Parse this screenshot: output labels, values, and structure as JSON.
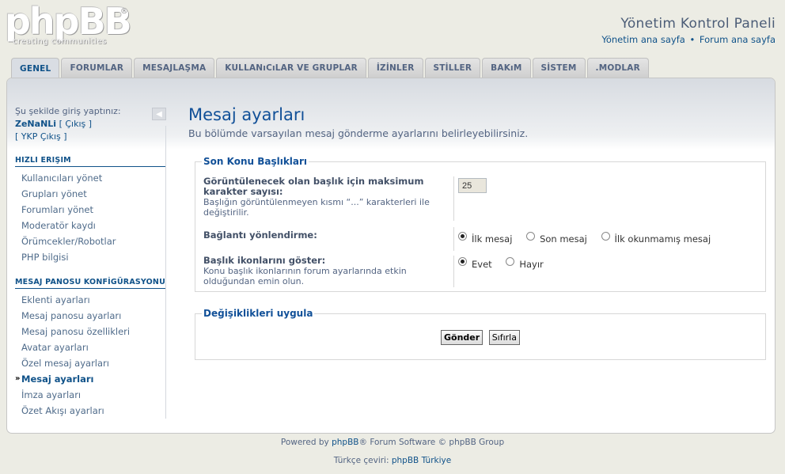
{
  "logo": {
    "word": "phpBB",
    "reg": "®",
    "tagline": "creating communities"
  },
  "header": {
    "title": "Yönetim Kontrol Paneli",
    "link_admin_home": "Yönetim ana sayfa",
    "separator": "•",
    "link_forum_home": "Forum ana sayfa"
  },
  "tabs": [
    {
      "label": "GENEL",
      "active": true
    },
    {
      "label": "FORUMLAR"
    },
    {
      "label": "MESAJLAŞMA"
    },
    {
      "label": "KULLANıCıLAR VE GRUPLAR"
    },
    {
      "label": "İZİNLER"
    },
    {
      "label": "STİLLER"
    },
    {
      "label": "BAKıM"
    },
    {
      "label": "SİSTEM"
    },
    {
      "label": ".MODLAR"
    }
  ],
  "sidebar": {
    "login_prefix": "Şu şekilde giriş yaptınız:",
    "username": "ZeNaNLi",
    "logout": "[ Çıkış ]",
    "ykp_logout": "[ YKP Çıkış ]",
    "quick_access": {
      "heading": "HıZLı ERIŞIM",
      "items": [
        "Kullanıcıları yönet",
        "Grupları yönet",
        "Forumları yönet",
        "Moderatör kaydı",
        "Örümcekler/Robotlar",
        "PHP bilgisi"
      ]
    },
    "board_config": {
      "heading": "MESAJ PANOSU KONFİGÜRASYONU",
      "items": [
        "Eklenti ayarları",
        "Mesaj panosu ayarları",
        "Mesaj panosu özellikleri",
        "Avatar ayarları",
        "Özel mesaj ayarları",
        "Mesaj ayarları",
        "İmza ayarları",
        "Özet Akışı ayarları"
      ],
      "active_index": 5
    }
  },
  "content": {
    "title": "Mesaj ayarları",
    "description": "Bu bölümde varsayılan mesaj gönderme ayarlarını belirleyebilirsiniz.",
    "fieldset1": {
      "legend": "Son Konu Başlıkları",
      "rows": [
        {
          "title": "Görüntülenecek olan başlık için maksimum karakter sayısı:",
          "desc": "Başlığın görüntülenmeyen kısmı “...” karakterleri ile değiştirilir.",
          "value": "25"
        },
        {
          "title": "Bağlantı yönlendirme:",
          "options": [
            "İlk mesaj",
            "Son mesaj",
            "İlk okunmamış mesaj"
          ],
          "selected": 0
        },
        {
          "title": "Başlık ikonlarını göster:",
          "desc": "Konu başlık ikonlarının forum ayarlarında etkin olduğundan emin olun.",
          "options": [
            "Evet",
            "Hayır"
          ],
          "selected": 0
        }
      ]
    },
    "fieldset2": {
      "legend": "Değişiklikleri uygula",
      "submit": "Gönder",
      "reset": "Sıfırla"
    }
  },
  "footer": {
    "line1_prefix": "Powered by ",
    "line1_link": "phpBB",
    "line1_suffix": "® Forum Software © phpBB Group",
    "line2_prefix": "Türkçe çeviri: ",
    "line2_link": "phpBB Türkiye"
  }
}
